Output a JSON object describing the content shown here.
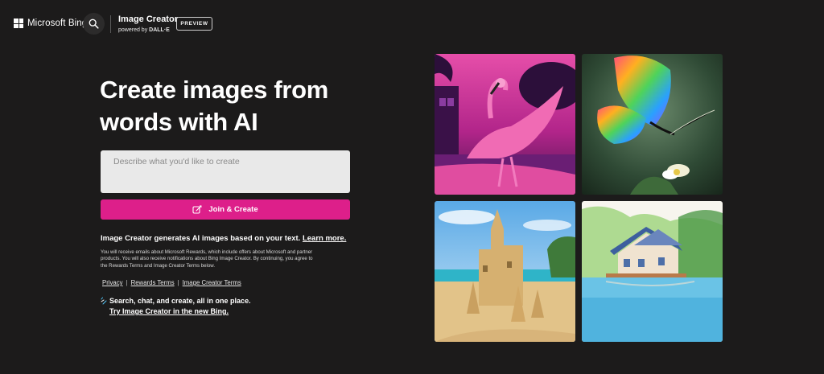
{
  "header": {
    "brand_name": "Microsoft Bing",
    "search_icon": "search-icon",
    "product_title": "Image Creator",
    "powered_by_prefix": "powered by",
    "powered_by_brand": "DALL·E",
    "preview_badge": "PREVIEW"
  },
  "hero": {
    "title_line1": "Create images from",
    "title_line2": "words with AI"
  },
  "prompt": {
    "placeholder": "Describe what you'd like to create",
    "value": ""
  },
  "join_button": {
    "label": "Join & Create",
    "icon": "create-icon",
    "color": "#dd1f8a"
  },
  "info": {
    "main_text": "Image Creator generates AI images based on your text.",
    "learn_more": "Learn more.",
    "disclaimer": "You will receive emails about Microsoft Rewards, which include offers about Microsoft and partner products. You will also receive notifications about Bing Image Creator. By continuing, you agree to the Rewards Terms and Image Creator Terms below."
  },
  "terms": {
    "privacy": "Privacy",
    "separator": "|",
    "rewards_terms": "Rewards Terms",
    "image_creator_terms": "Image Creator Terms"
  },
  "promo": {
    "icon": "sparkle-icon",
    "line1": "Search, chat, and create, all in one place.",
    "line2": "Try Image Creator in the new Bing."
  },
  "gallery": {
    "images": [
      "flamingo-image",
      "butterfly-image",
      "sandcastle-image",
      "lake-house-image"
    ]
  },
  "colors": {
    "background": "#1c1b1b",
    "accent": "#dd1f8a",
    "input_bg": "#e9e9e9"
  }
}
